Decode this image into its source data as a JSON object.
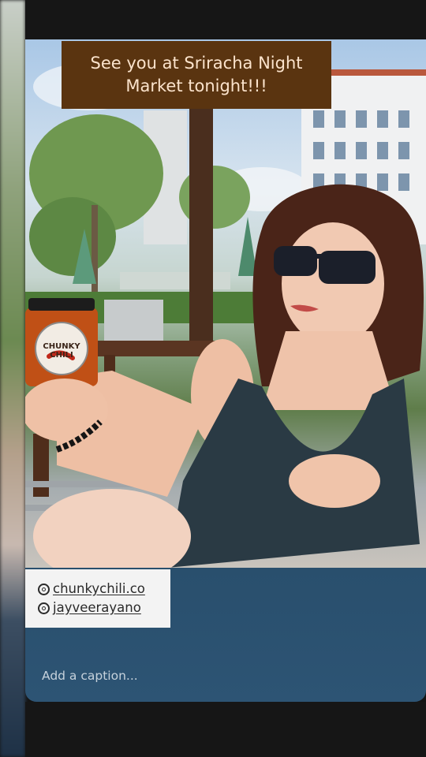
{
  "story": {
    "banner_line1": "See you at Sriracha Night",
    "banner_line2": "Market tonight!!!",
    "jar_label": "CHUNKY CHILI"
  },
  "mentions": [
    {
      "icon": "threads-icon",
      "handle": "chunkychili.co"
    },
    {
      "icon": "threads-icon",
      "handle": "jayveerayano"
    }
  ],
  "caption": {
    "placeholder": "Add a caption..."
  },
  "colors": {
    "banner_bg": "#5a3410",
    "banner_text": "#fbe3cc",
    "panel_blue": "#254a66"
  }
}
